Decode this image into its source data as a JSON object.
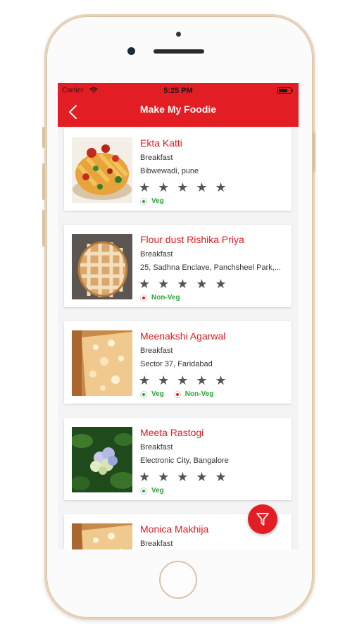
{
  "status_bar": {
    "carrier": "Carrier",
    "time": "5:25 PM"
  },
  "nav": {
    "title": "Make My Foodie"
  },
  "colors": {
    "brand": "#e31d24",
    "veg": "#2da33a",
    "name": "#d72128"
  },
  "icons": {
    "back": "chevron-left-icon",
    "filter": "filter-funnel-icon",
    "wifi": "wifi-icon",
    "battery": "battery-icon",
    "star": "star-icon"
  },
  "restaurants": [
    {
      "name": "Ekta Katti",
      "category": "Breakfast",
      "address": "Bibwewadi, pune",
      "stars": "★ ★ ★ ★ ★",
      "tags": [
        {
          "label": "Veg",
          "type": "veg"
        }
      ]
    },
    {
      "name": "Flour dust Rishika Priya",
      "category": "Breakfast",
      "address": "25, Sadhna Enclave, Panchsheel Park,...",
      "stars": "★ ★ ★ ★ ★",
      "tags": [
        {
          "label": "Non-Veg",
          "type": "nonveg"
        }
      ]
    },
    {
      "name": "Meenakshi Agarwal",
      "category": "Breakfast",
      "address": "Sector 37, Faridabad",
      "stars": "★ ★ ★ ★ ★",
      "tags": [
        {
          "label": "Veg",
          "type": "veg"
        },
        {
          "label": "Non-Veg",
          "type": "nonveg"
        }
      ]
    },
    {
      "name": "Meeta Rastogi",
      "category": "Breakfast",
      "address": "Electronic City, Bangalore",
      "stars": "★ ★ ★ ★ ★",
      "tags": [
        {
          "label": "Veg",
          "type": "veg"
        }
      ]
    },
    {
      "name": "Monica Makhija",
      "category": "Breakfast"
    }
  ]
}
